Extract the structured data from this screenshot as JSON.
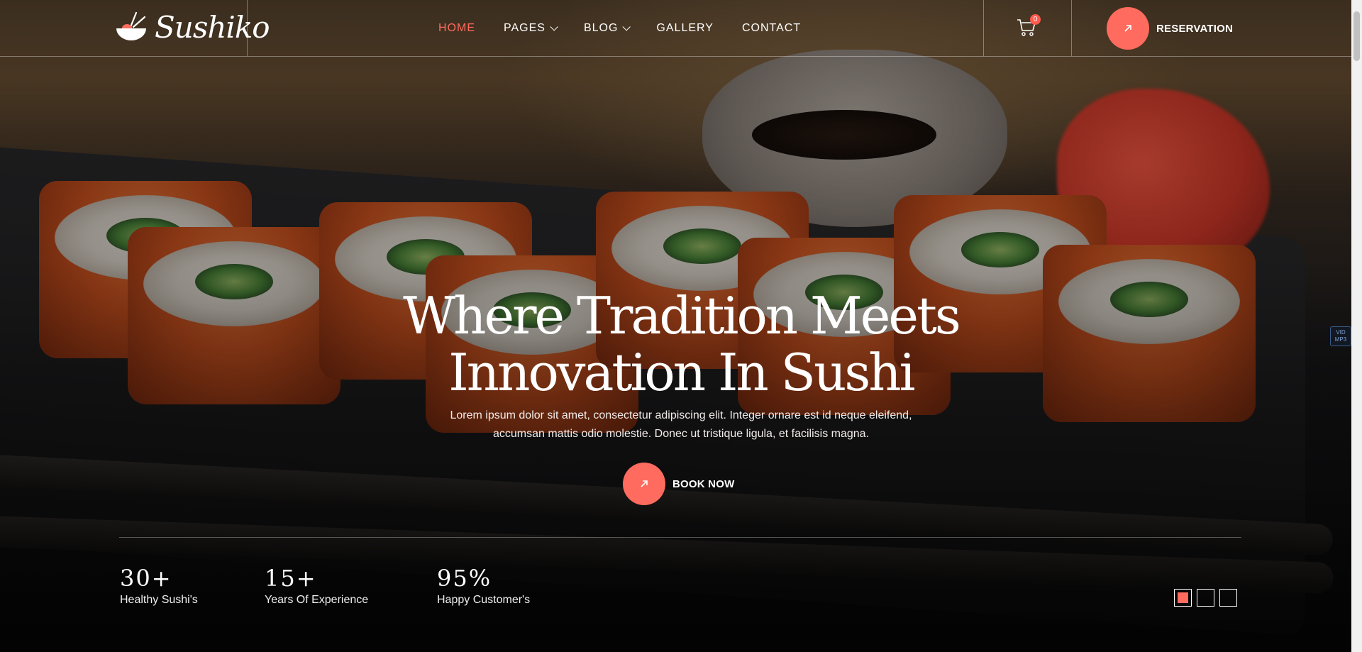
{
  "brand": {
    "name": "Sushiko"
  },
  "nav": {
    "items": [
      {
        "label": "HOME",
        "active": true,
        "dropdown": false
      },
      {
        "label": "PAGES",
        "active": false,
        "dropdown": true
      },
      {
        "label": "BLOG",
        "active": false,
        "dropdown": true
      },
      {
        "label": "GALLERY",
        "active": false,
        "dropdown": false
      },
      {
        "label": "CONTACT",
        "active": false,
        "dropdown": false
      }
    ]
  },
  "cart": {
    "count": "0",
    "icon": "cart-icon"
  },
  "reservation": {
    "label": "RESERVATION",
    "icon": "arrow-up-right-icon"
  },
  "hero": {
    "title_line1": "Where Tradition Meets",
    "title_line2": "Innovation In Sushi",
    "description_line1": "Lorem ipsum dolor sit amet, consectetur adipiscing elit. Integer ornare est id neque eleifend,",
    "description_line2": "accumsan mattis odio molestie. Donec ut tristique ligula, et facilisis magna.",
    "cta_label": "BOOK NOW"
  },
  "stats": [
    {
      "value": "30+",
      "label": "Healthy Sushi's"
    },
    {
      "value": "15+",
      "label": "Years Of Experience"
    },
    {
      "value": "95%",
      "label": "Happy Customer's"
    }
  ],
  "slider": {
    "count": 3,
    "active_index": 0
  },
  "side_tag": {
    "line1": "VID",
    "line2": "MP3"
  },
  "colors": {
    "accent": "#ff6b5e",
    "text": "#ffffff"
  }
}
